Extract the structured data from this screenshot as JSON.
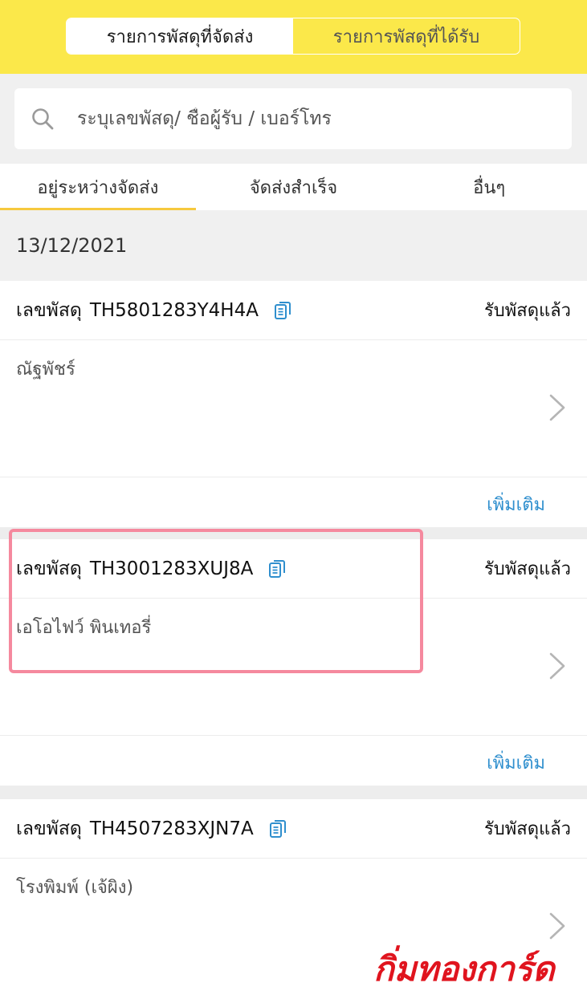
{
  "header": {
    "segments": [
      {
        "label": "รายการพัสดุที่จัดส่ง",
        "active": true
      },
      {
        "label": "รายการพัสดุที่ได้รับ",
        "active": false
      }
    ],
    "background_color": "#fbe84a"
  },
  "search": {
    "icon": "search-icon",
    "placeholder": "ระบุเลขพัสดุ/ ชื่อผู้รับ / เบอร์โทร"
  },
  "tabs": [
    {
      "label": "อยู่ระหว่างจัดส่ง",
      "active": true
    },
    {
      "label": "จัดส่งสำเร็จ",
      "active": false
    },
    {
      "label": "อื่นๆ",
      "active": false
    }
  ],
  "date_header": "13/12/2021",
  "cards": [
    {
      "label": "เลขพัสดุ",
      "tracking": "TH5801283Y4H4A",
      "status": "รับพัสดุแล้ว",
      "recipient": "ณัฐพัชร์",
      "more": "เพิ่มเติม"
    },
    {
      "label": "เลขพัสดุ",
      "tracking": "TH3001283XUJ8A",
      "status": "รับพัสดุแล้ว",
      "recipient": "เอโอไฟว์ พินเทอรี่",
      "more": "เพิ่มเติม",
      "highlighted": true
    },
    {
      "label": "เลขพัสดุ",
      "tracking": "TH4507283XJN7A",
      "status": "รับพัสดุแล้ว",
      "recipient": "โรงพิมพ์ (เจ้ผิง)"
    }
  ],
  "watermark": {
    "text": "กิ่มทองการ์ด",
    "color": "#e0141e"
  },
  "colors": {
    "accent_yellow": "#fbe84a",
    "tab_underline": "#f6c93e",
    "link_blue": "#2f8fce",
    "highlight_pink": "#f5899e"
  }
}
